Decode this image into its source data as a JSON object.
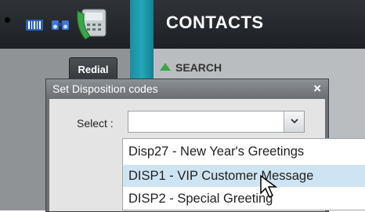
{
  "header": {
    "title": "CONTACTS"
  },
  "toolbar": {
    "icons": [
      "barcode-icon",
      "binoculars-icon",
      "phone-icon"
    ]
  },
  "buttons": {
    "redial_label": "Redial"
  },
  "section": {
    "search_label": "SEARCH"
  },
  "dialog": {
    "title": "Set Disposition codes",
    "close_glyph": "×",
    "select_label": "Select :",
    "select_value": "",
    "options": [
      {
        "label": "Disp27 - New Year's Greetings",
        "highlighted": false
      },
      {
        "label": "DISP1 - VIP Customer Message",
        "highlighted": true
      },
      {
        "label": "DISP2 - Special Greeting",
        "highlighted": false
      }
    ]
  },
  "colors": {
    "accent_teal": "#1a8ea0",
    "highlight": "#cfe4f2",
    "search_arrow": "#3fa34a"
  }
}
